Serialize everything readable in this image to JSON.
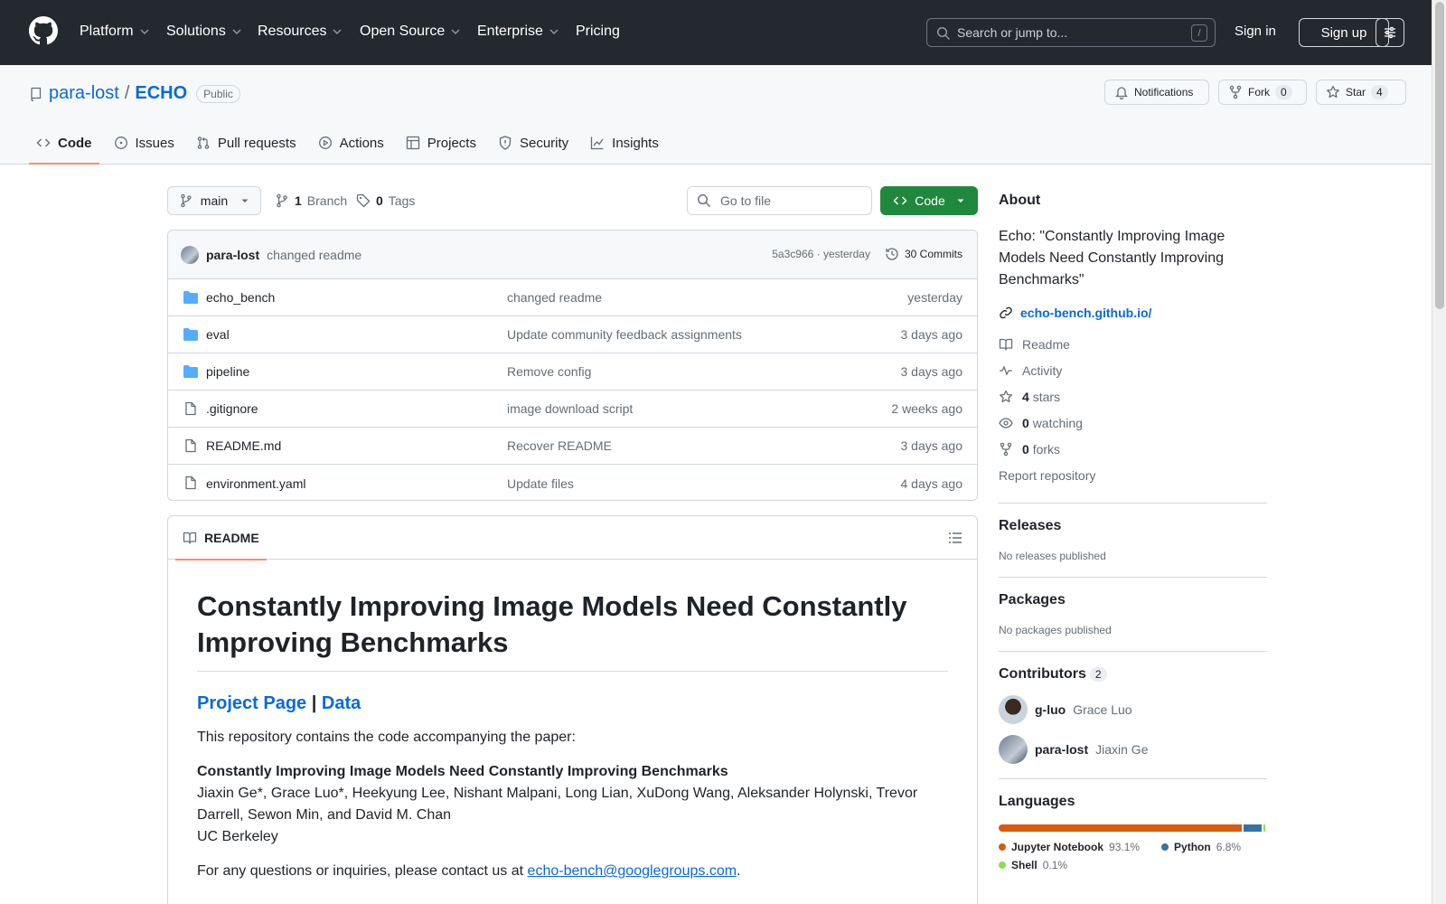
{
  "topnav": {
    "items": [
      "Platform",
      "Solutions",
      "Resources",
      "Open Source",
      "Enterprise",
      "Pricing"
    ],
    "search_placeholder": "Search or jump to...",
    "slash": "/",
    "signin": "Sign in",
    "signup": "Sign up"
  },
  "repo": {
    "owner": "para-lost",
    "slash": "/",
    "name": "ECHO",
    "visibility": "Public",
    "notifications": "Notifications",
    "fork_label": "Fork",
    "fork_count": "0",
    "star_label": "Star",
    "star_count": "4"
  },
  "tabs": [
    "Code",
    "Issues",
    "Pull requests",
    "Actions",
    "Projects",
    "Security",
    "Insights"
  ],
  "toolbar": {
    "branch": "main",
    "branches_count": "1",
    "branches_label": "Branch",
    "tags_count": "0",
    "tags_label": "Tags",
    "goto_placeholder": "Go to file",
    "code_button": "Code"
  },
  "latest_commit": {
    "author": "para-lost",
    "message": "changed readme",
    "hash_time": "5a3c966 · yesterday",
    "commits": "30 Commits"
  },
  "files": [
    {
      "type": "dir",
      "name": "echo_bench",
      "message": "changed readme",
      "date": "yesterday"
    },
    {
      "type": "dir",
      "name": "eval",
      "message": "Update community feedback assignments",
      "date": "3 days ago"
    },
    {
      "type": "dir",
      "name": "pipeline",
      "message": "Remove config",
      "date": "3 days ago"
    },
    {
      "type": "file",
      "name": ".gitignore",
      "message": "image download script",
      "date": "2 weeks ago"
    },
    {
      "type": "file",
      "name": "README.md",
      "message": "Recover README",
      "date": "3 days ago"
    },
    {
      "type": "file",
      "name": "environment.yaml",
      "message": "Update files",
      "date": "4 days ago"
    }
  ],
  "readme": {
    "tab": "README",
    "title": "Constantly Improving Image Models Need Constantly Improving Benchmarks",
    "link_project": "Project Page",
    "link_sep": "|",
    "link_data": "Data",
    "intro": "This repository contains the code accompanying the paper:",
    "paper_title": "Constantly Improving Image Models Need Constantly Improving Benchmarks",
    "authors": "Jiaxin Ge*, Grace Luo*, Heekyung Lee, Nishant Malpani, Long Lian, XuDong Wang, Aleksander Holynski, Trevor Darrell, Sewon Min, and David M. Chan",
    "affiliation": "UC Berkeley",
    "contact_prefix": "For any questions or inquiries, please contact us at",
    "contact_email": "echo-bench@googlegroups.com",
    "contact_suffix": "."
  },
  "about": {
    "heading": "About",
    "description": "Echo: \"Constantly Improving Image Models Need Constantly Improving Benchmarks\"",
    "website": "echo-bench.github.io/",
    "readme": "Readme",
    "activity": "Activity",
    "stars_count": "4",
    "stars_label": "stars",
    "watching_count": "0",
    "watching_label": "watching",
    "forks_count": "0",
    "forks_label": "forks",
    "report": "Report repository"
  },
  "releases": {
    "heading": "Releases",
    "empty": "No releases published"
  },
  "packages": {
    "heading": "Packages",
    "empty": "No packages published"
  },
  "contributors": {
    "heading": "Contributors",
    "count": "2",
    "items": [
      {
        "login": "g-luo",
        "name": "Grace Luo"
      },
      {
        "login": "para-lost",
        "name": "Jiaxin Ge"
      }
    ]
  },
  "languages": {
    "heading": "Languages",
    "items": [
      {
        "name": "Jupyter Notebook",
        "percent": "93.1%",
        "value": 93.1,
        "color": "#DA5B0B"
      },
      {
        "name": "Python",
        "percent": "6.8%",
        "value": 6.8,
        "color": "#3572A5"
      },
      {
        "name": "Shell",
        "percent": "0.1%",
        "value": 0.1,
        "color": "#89e051"
      }
    ]
  }
}
